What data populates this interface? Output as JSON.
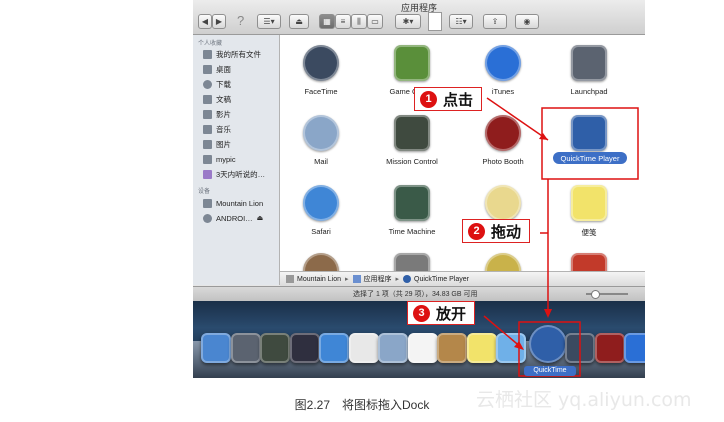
{
  "window": {
    "title": "应用程序"
  },
  "toolbar": {
    "back": "◀",
    "forward": "▶",
    "help": "?",
    "eject": "⏏",
    "settings": "✱▾",
    "share": "⇪",
    "view": "◉"
  },
  "sidebar": {
    "favorites_header": "个人收藏",
    "favorites": [
      {
        "label": "我的所有文件",
        "icon": "all-files-icon"
      },
      {
        "label": "桌面",
        "icon": "desktop-icon"
      },
      {
        "label": "下载",
        "icon": "downloads-icon"
      },
      {
        "label": "文稿",
        "icon": "documents-icon"
      },
      {
        "label": "影片",
        "icon": "movies-icon"
      },
      {
        "label": "音乐",
        "icon": "music-icon"
      },
      {
        "label": "图片",
        "icon": "pictures-icon"
      },
      {
        "label": "mypic",
        "icon": "folder-icon"
      },
      {
        "label": "3天内听说的…",
        "icon": "smart-folder-icon"
      }
    ],
    "devices_header": "设备",
    "devices": [
      {
        "label": "Mountain Lion",
        "icon": "hard-drive-icon"
      },
      {
        "label": "ANDROI…",
        "icon": "disk-icon",
        "eject": "⏏"
      }
    ]
  },
  "apps": [
    {
      "label": "FaceTime",
      "icon": "facetime-icon",
      "color": "#3b4a60"
    },
    {
      "label": "Game Center",
      "icon": "game-center-icon",
      "color": "#5a8f3a"
    },
    {
      "label": "iTunes",
      "icon": "itunes-icon",
      "color": "#2a6fd6"
    },
    {
      "label": "Launchpad",
      "icon": "launchpad-icon",
      "color": "#5b6370"
    },
    {
      "label": "Mail",
      "icon": "mail-icon",
      "color": "#8aa6c8"
    },
    {
      "label": "Mission Control",
      "icon": "mission-control-icon",
      "color": "#3f4a3f"
    },
    {
      "label": "Photo Booth",
      "icon": "photo-booth-icon",
      "color": "#8f1d1d"
    },
    {
      "label": "QuickTime Player",
      "icon": "quicktime-icon",
      "color": "#2f5fa8"
    },
    {
      "label": "Safari",
      "icon": "safari-icon",
      "color": "#3f86d6"
    },
    {
      "label": "Time Machine",
      "icon": "time-machine-icon",
      "color": "#3a5a48"
    },
    {
      "label": "",
      "icon": "textedit-icon",
      "color": "#e9d88e"
    },
    {
      "label": "便笺",
      "icon": "stickies-icon",
      "color": "#f2e36a"
    },
    {
      "label": "",
      "icon": "book-icon",
      "color": "#8c6a4a"
    },
    {
      "label": "",
      "icon": "system-icon",
      "color": "#7a7a7a"
    },
    {
      "label": "",
      "icon": "coin-icon",
      "color": "#c9b24a"
    },
    {
      "label": "",
      "icon": "calendar-icon",
      "color": "#c23a2a"
    }
  ],
  "pathbar": {
    "items": [
      "Mountain Lion",
      "应用程序",
      "QuickTime Player"
    ],
    "sep": "▸"
  },
  "statusbar": {
    "text": "选择了 1 项（共 29 项），34.83 GB 可用"
  },
  "dock": {
    "items": [
      {
        "icon": "finder-icon",
        "color": "#4a86d0"
      },
      {
        "icon": "launchpad-dock-icon",
        "color": "#5b6370"
      },
      {
        "icon": "mission-control-dock-icon",
        "color": "#3f4a3f"
      },
      {
        "icon": "dashboard-icon",
        "color": "#2f2f3f"
      },
      {
        "icon": "safari-dock-icon",
        "color": "#3f86d6"
      },
      {
        "icon": "calendar-dock-icon",
        "color": "#e8e8e8"
      },
      {
        "icon": "mail-dock-icon",
        "color": "#8aa6c8"
      },
      {
        "icon": "reminders-icon",
        "color": "#f4f4f4"
      },
      {
        "icon": "contacts-icon",
        "color": "#b4874a"
      },
      {
        "icon": "notes-icon",
        "color": "#f2e36a"
      },
      {
        "icon": "messages-icon",
        "color": "#6fb0e8"
      },
      {
        "icon": "quicktime-dock-icon",
        "color": "#2f5fa8"
      },
      {
        "icon": "facetime-dock-icon",
        "color": "#3b4a60"
      },
      {
        "icon": "photo-booth-dock-icon",
        "color": "#8f1d1d"
      },
      {
        "icon": "itunes-dock-icon",
        "color": "#2a6fd6"
      }
    ],
    "drag_label": "QuickTime"
  },
  "callouts": [
    {
      "num": "1",
      "text": "点击"
    },
    {
      "num": "2",
      "text": "拖动"
    },
    {
      "num": "3",
      "text": "放开"
    }
  ],
  "caption": "图2.27　将图标拖入Dock",
  "watermark": "云栖社区 yq.aliyun.com",
  "colors": {
    "callout_red": "#d11111",
    "selection_blue": "#3d6fc6"
  }
}
